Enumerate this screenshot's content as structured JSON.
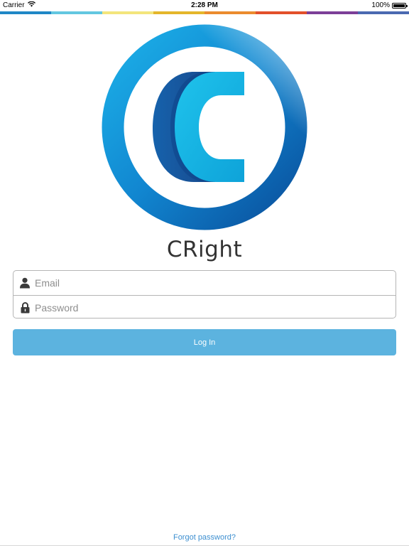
{
  "status_bar": {
    "carrier": "Carrier",
    "time": "2:28 PM",
    "battery": "100%",
    "battery_level": 1.0
  },
  "stripe_colors": [
    "#1f87c6",
    "#63c7e0",
    "#f3e57c",
    "#e4b62b",
    "#eb8b2e",
    "#e2502b",
    "#7c3f98",
    "#4a69b1"
  ],
  "logo": {
    "icon": "copyright-logo-icon",
    "ring_color_outer": "#0a5fae",
    "ring_color_inner": "#1aa0e0",
    "c_color_dark": "#0c4f9a",
    "c_color_light": "#1eb2e2"
  },
  "app": {
    "name": "CRight"
  },
  "login_form": {
    "email_placeholder": "Email",
    "email_value": "",
    "password_placeholder": "Password",
    "password_value": "",
    "email_icon": "user-icon",
    "password_icon": "lock-icon"
  },
  "login_button": {
    "label": "Log In",
    "color": "#5cb3df"
  },
  "forgot_password": {
    "label": "Forgot password?",
    "color": "#3d8fd0"
  }
}
